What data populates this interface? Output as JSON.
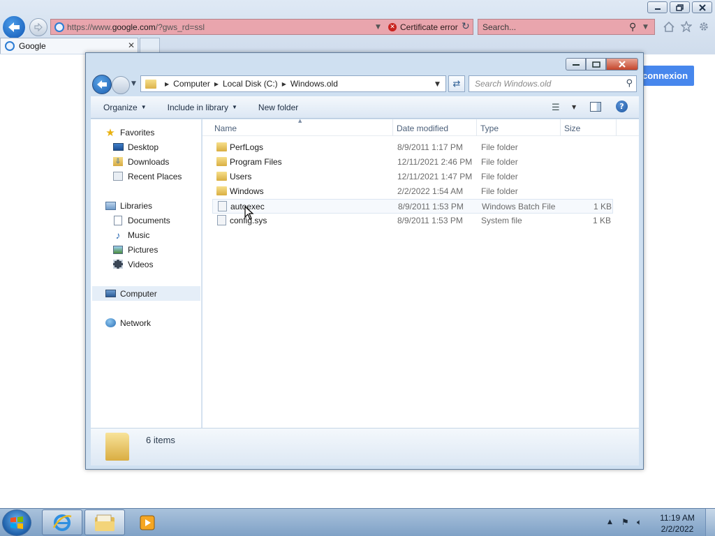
{
  "ie": {
    "url_prefix": "https://www.",
    "url_domain": "google.com",
    "url_suffix": "/?gws_rd=ssl",
    "cert_error": "Certificate error",
    "search_placeholder": "Search...",
    "tab_title": "Google",
    "page_button": "connexion"
  },
  "explorer": {
    "breadcrumb": [
      "Computer",
      "Local Disk (C:)",
      "Windows.old"
    ],
    "search_placeholder": "Search Windows.old",
    "commands": {
      "organize": "Organize",
      "include_in_library": "Include in library",
      "new_folder": "New folder"
    },
    "nav": {
      "favorites": "Favorites",
      "desktop": "Desktop",
      "downloads": "Downloads",
      "recent_places": "Recent Places",
      "libraries": "Libraries",
      "documents": "Documents",
      "music": "Music",
      "pictures": "Pictures",
      "videos": "Videos",
      "computer": "Computer",
      "network": "Network"
    },
    "columns": {
      "name": "Name",
      "date_modified": "Date modified",
      "type": "Type",
      "size": "Size"
    },
    "files": [
      {
        "name": "PerfLogs",
        "date": "8/9/2011 1:17 PM",
        "type": "File folder",
        "size": "",
        "kind": "folder"
      },
      {
        "name": "Program Files",
        "date": "12/11/2021 2:46 PM",
        "type": "File folder",
        "size": "",
        "kind": "folder"
      },
      {
        "name": "Users",
        "date": "12/11/2021 1:47 PM",
        "type": "File folder",
        "size": "",
        "kind": "folder"
      },
      {
        "name": "Windows",
        "date": "2/2/2022 1:54 AM",
        "type": "File folder",
        "size": "",
        "kind": "folder"
      },
      {
        "name": "autoexec",
        "date": "8/9/2011 1:53 PM",
        "type": "Windows Batch File",
        "size": "1 KB",
        "kind": "file"
      },
      {
        "name": "config.sys",
        "date": "8/9/2011 1:53 PM",
        "type": "System file",
        "size": "1 KB",
        "kind": "file"
      }
    ],
    "item_count": "6 items"
  },
  "taskbar": {
    "time": "11:19 AM",
    "date": "2/2/2022"
  }
}
